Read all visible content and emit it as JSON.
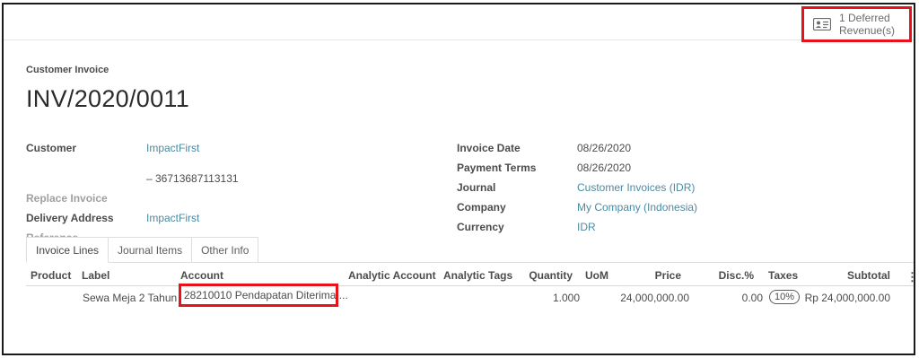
{
  "deferred_button": {
    "line1": "1 Deferred",
    "line2": "Revenue(s)",
    "icon": "id-card-icon"
  },
  "invoice": {
    "type_label": "Customer Invoice",
    "number": "INV/2020/0011"
  },
  "left_fields": {
    "customer_label": "Customer",
    "customer_value": "ImpactFirst",
    "customer_extra": "– 36713687113131",
    "replace_invoice_label": "Replace Invoice",
    "delivery_label": "Delivery Address",
    "delivery_value": "ImpactFirst",
    "reference_label": "Reference"
  },
  "right_fields": {
    "invoice_date_label": "Invoice Date",
    "invoice_date_value": "08/26/2020",
    "payment_terms_label": "Payment Terms",
    "payment_terms_value": "08/26/2020",
    "journal_label": "Journal",
    "journal_value": "Customer Invoices (IDR)",
    "company_label": "Company",
    "company_value": "My Company (Indonesia)",
    "currency_label": "Currency",
    "currency_value": "IDR"
  },
  "tabs": [
    {
      "label": "Invoice Lines",
      "active": true
    },
    {
      "label": "Journal Items",
      "active": false
    },
    {
      "label": "Other Info",
      "active": false
    }
  ],
  "columns": {
    "product": "Product",
    "label": "Label",
    "account": "Account",
    "analytic_account": "Analytic Account",
    "analytic_tags": "Analytic Tags",
    "quantity": "Quantity",
    "uom": "UoM",
    "price": "Price",
    "disc": "Disc.%",
    "taxes": "Taxes",
    "subtotal": "Subtotal"
  },
  "row": {
    "label": "Sewa Meja 2 Tahun",
    "account": "28210010 Pendapatan Diterima ...",
    "quantity": "1.000",
    "price": "24,000,000.00",
    "disc": "0.00",
    "tax": "10%",
    "subtotal": "Rp 24,000,000.00"
  },
  "colors": {
    "highlight": "#e8121b",
    "link": "#4a8ba3"
  }
}
